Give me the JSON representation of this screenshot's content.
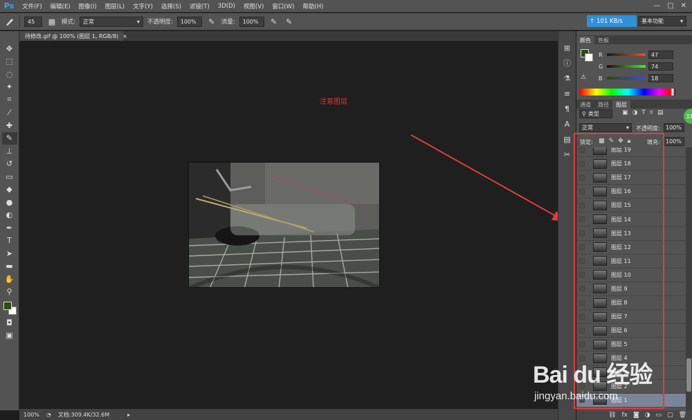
{
  "app": {
    "logo": "Ps"
  },
  "menu": [
    "文件(F)",
    "编辑(E)",
    "图像(I)",
    "图层(L)",
    "文字(Y)",
    "选择(S)",
    "滤镜(T)",
    "3D(D)",
    "视图(V)",
    "窗口(W)",
    "帮助(H)"
  ],
  "window_controls": {
    "minimize": "—",
    "maximize": "□",
    "close": "✕"
  },
  "options": {
    "brush_size": "45",
    "mode_label": "模式:",
    "mode_value": "正常",
    "opacity_label": "不透明度:",
    "opacity_value": "100%",
    "flow_label": "流量:",
    "flow_value": "100%",
    "speed": "101 KB/s",
    "workspace": "基本功能"
  },
  "document": {
    "tab_title": "待修改.gif @ 100% (图层 1, RGB/8)",
    "annotation": "注意图层",
    "zoom": "100%",
    "doc_info": "文档:309.4K/32.6M"
  },
  "color_panel": {
    "tabs": [
      "颜色",
      "色板"
    ],
    "r": {
      "label": "R",
      "value": "47"
    },
    "g": {
      "label": "G",
      "value": "74"
    },
    "b": {
      "label": "B",
      "value": "18"
    },
    "foreground": "#2f4a12"
  },
  "layers_panel": {
    "tabs": [
      "通道",
      "路径",
      "图层"
    ],
    "filter_label": "类型",
    "blend_mode": "正常",
    "opacity_label": "不透明度:",
    "opacity_value": "100%",
    "lock_label": "锁定:",
    "fill_label": "填充:",
    "fill_value": "100%",
    "badge": "33",
    "layers": [
      "图层 19",
      "图层 18",
      "图层 17",
      "图层 16",
      "图层 15",
      "图层 14",
      "图层 13",
      "图层 12",
      "图层 11",
      "图层 10",
      "图层 9",
      "图层 8",
      "图层 7",
      "图层 6",
      "图层 5",
      "图层 4",
      "图层 3",
      "图层 2",
      "图层 1"
    ]
  },
  "watermark": {
    "brand": "Bai du 经验",
    "url": "jingyan.baidu.com"
  }
}
